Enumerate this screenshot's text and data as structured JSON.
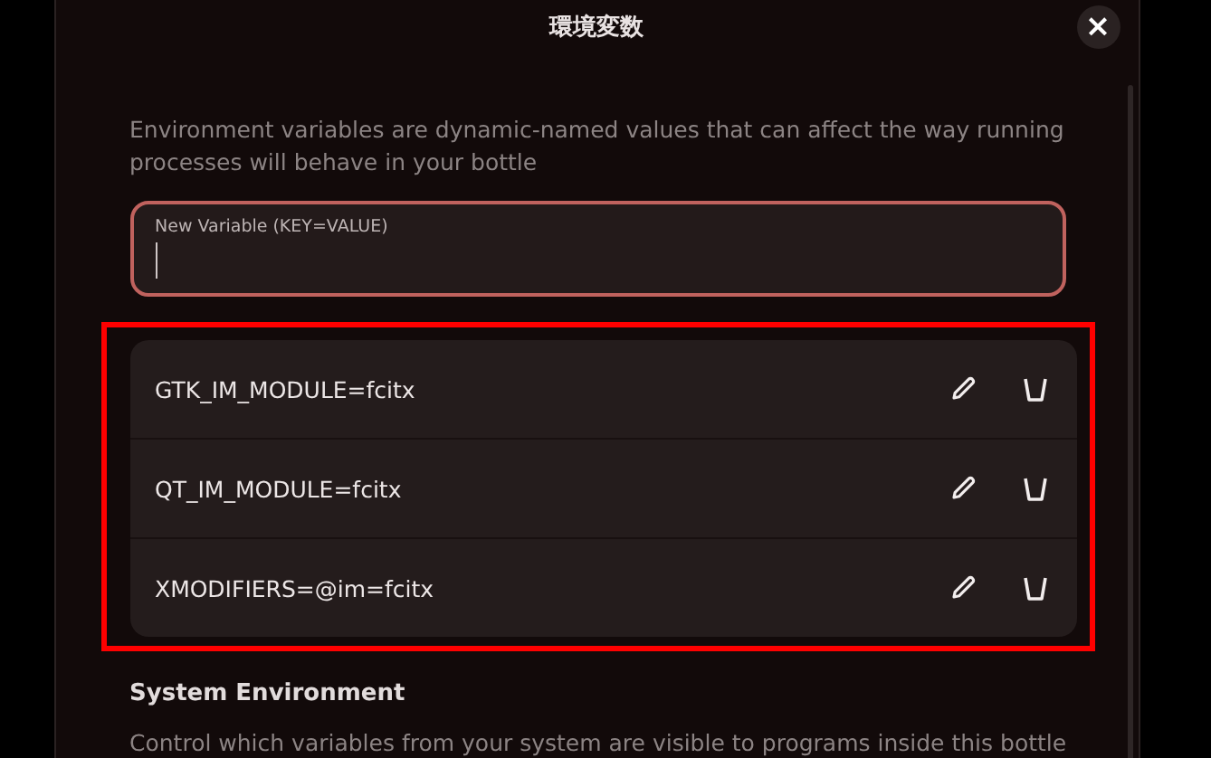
{
  "dialog": {
    "title": "環境変数",
    "close": "×"
  },
  "description": "Environment variables are dynamic-named values that can affect the way running processes will behave in your bottle",
  "new_variable": {
    "label": "New Variable (KEY=VALUE)"
  },
  "variables": [
    {
      "value": "GTK_IM_MODULE=fcitx"
    },
    {
      "value": "QT_IM_MODULE=fcitx"
    },
    {
      "value": "XMODIFIERS=@im=fcitx"
    }
  ],
  "system_environment": {
    "title": "System Environment",
    "description": "Control which variables from your system are visible to programs inside this bottle"
  }
}
